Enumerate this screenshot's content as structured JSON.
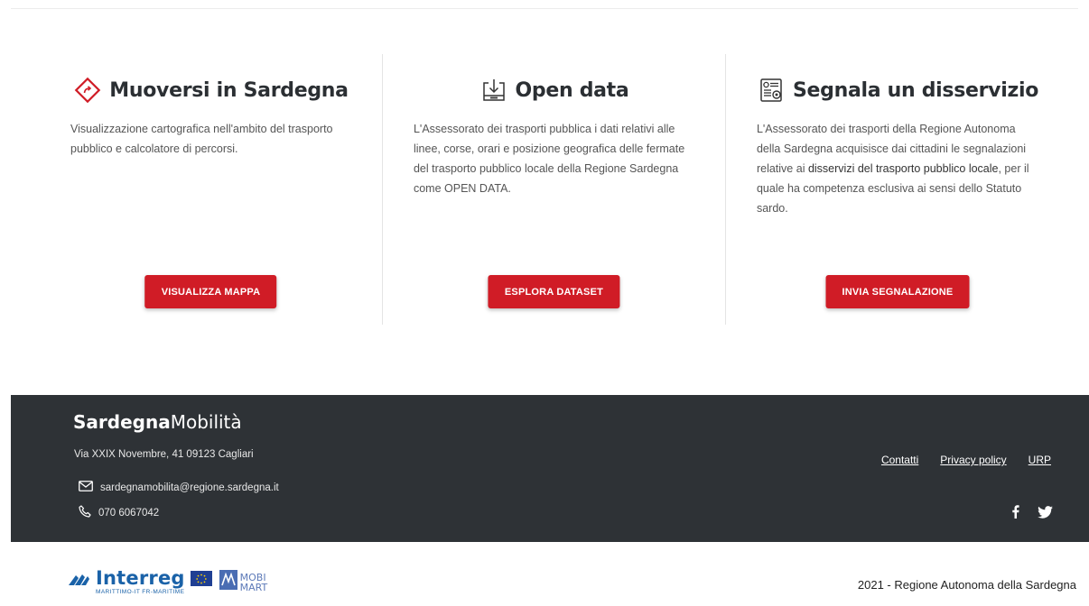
{
  "cards": [
    {
      "title": "Muoversi in Sardegna",
      "icon": "map-diamond-icon",
      "description": "Visualizzazione cartografica nell'ambito del trasporto pubblico e calcolatore di percorsi.",
      "button": "VISUALIZZA MAPPA"
    },
    {
      "title": "Open data",
      "icon": "download-data-icon",
      "description": "L'Assessorato dei trasporti pubblica i dati relativi alle linee, corse, orari e posizione geografica delle fermate del trasporto pubblico locale della Regione Sardegna come OPEN DATA.",
      "button": "ESPLORA DATASET"
    },
    {
      "title": "Segnala un disservizio",
      "icon": "report-form-icon",
      "description_before": "L'Assessorato dei trasporti della Regione Autonoma della Sardegna acquisisce dai cittadini le segnalazioni relative ai ",
      "description_strong": "disservizi del trasporto pubblico locale",
      "description_after": ", per il quale ha competenza esclusiva ai sensi dello Statuto sardo.",
      "button": "INVIA SEGNALAZIONE"
    }
  ],
  "footer": {
    "brand_bold": "Sardegna",
    "brand_light": "Mobilità",
    "address": "Via XXIX Novembre, 41 09123 Cagliari",
    "email": "sardegnamobilita@regione.sardegna.it",
    "phone": "070 6067042",
    "links": [
      "Contatti",
      "Privacy policy",
      "URP"
    ],
    "social": [
      "facebook-icon",
      "twitter-icon"
    ]
  },
  "bottom": {
    "interreg": "Interreg",
    "interreg_sub": "MARITTIMO-IT FR-MARITIME",
    "mobimart_top": "MOBI",
    "mobimart_bottom": "MART",
    "copyright": "2021 - Regione Autonoma della Sardegna"
  },
  "colors": {
    "accent": "#d01c26",
    "footer_bg": "#2e3236"
  }
}
